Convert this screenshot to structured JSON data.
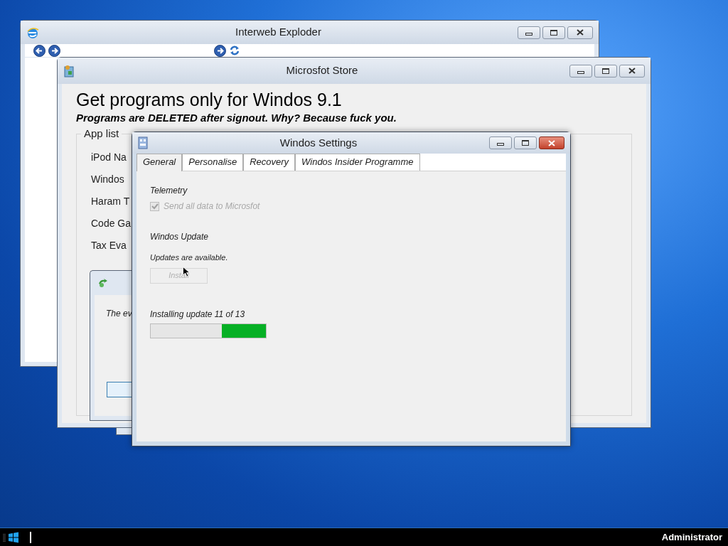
{
  "browser": {
    "title": "Interweb Exploder"
  },
  "store": {
    "title": "Microsfot Store",
    "heading": "Get programs only for Windos 9.1",
    "subheading": "Programs are DELETED after signout. Why? Because fuck you.",
    "app_list": {
      "label": "App list",
      "items": [
        "iPod Na",
        "Windos",
        "Haram T",
        "Code Ga",
        "Tax Eva"
      ]
    },
    "dialog": {
      "text": "The ev"
    }
  },
  "settings": {
    "title": "Windos Settings",
    "tabs": [
      {
        "label": "General",
        "selected": true
      },
      {
        "label": "Personalise",
        "selected": false
      },
      {
        "label": "Recovery",
        "selected": false
      },
      {
        "label": "Windos Insider Programme",
        "selected": false
      }
    ],
    "telemetry": {
      "heading": "Telemetry",
      "checkbox": {
        "label": "Send all data to Microsfot",
        "checked": true,
        "disabled": true
      }
    },
    "update": {
      "heading": "Windos Update",
      "status": "Updates are available.",
      "button": {
        "label": "Install",
        "disabled": true
      },
      "progress": {
        "label": "Installing update 11 of 13",
        "level": 0.38
      }
    }
  },
  "taskbar": {
    "user": "Administrator"
  }
}
